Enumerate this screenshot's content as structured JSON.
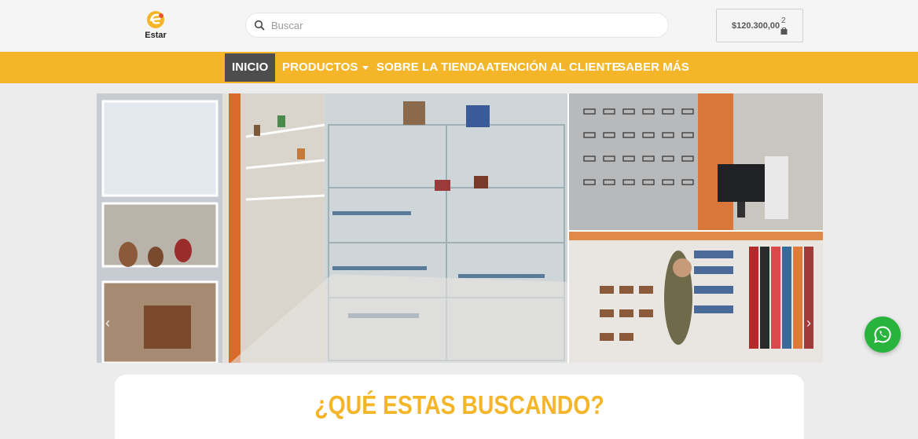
{
  "header": {
    "logo_text": "Estar",
    "search_placeholder": "Buscar",
    "search_value": "",
    "cart_total": "$120.300,00",
    "cart_count": "2"
  },
  "nav": {
    "items": [
      {
        "label": "INICIO",
        "active": true
      },
      {
        "label": "PRODUCTOS",
        "has_dropdown": true
      },
      {
        "label": "SOBRE LA TIENDA"
      },
      {
        "label": "ATENCIÓN AL CLIENTE"
      },
      {
        "label": "SABER MÁS"
      }
    ]
  },
  "slider": {
    "prev_arrow": "‹",
    "next_arrow": "›"
  },
  "section": {
    "title": "¿QUÉ ESTAS BUSCANDO?"
  },
  "colors": {
    "accent": "#f4b628",
    "nav_active_bg": "#4d4d4d",
    "whatsapp": "#28b43c"
  },
  "icons": {
    "search": "search-icon",
    "cart": "cart-icon",
    "whatsapp": "whatsapp-icon",
    "dropdown": "chevron-down-icon"
  }
}
